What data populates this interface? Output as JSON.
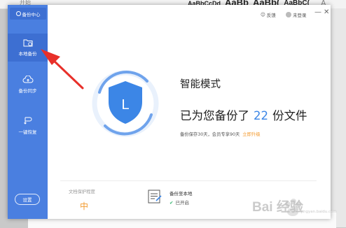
{
  "background": {
    "tab_label": "开始",
    "style_previews": [
      "AaBbCcDd",
      "AaBb",
      "AaBb(",
      "AaBbC("
    ]
  },
  "sidebar": {
    "title": "备份中心",
    "items": [
      {
        "label": "本地备份",
        "icon": "folder-clock-icon",
        "active": true
      },
      {
        "label": "备份同步",
        "icon": "cloud-upload-icon",
        "active": false
      },
      {
        "label": "一键恢复",
        "icon": "restore-icon",
        "active": false
      }
    ],
    "settings_label": "设置"
  },
  "topbar": {
    "feedback_label": "反馈",
    "login_label": "未登录",
    "minimize_symbol": "—",
    "close_symbol": "✕"
  },
  "main": {
    "mode_title": "智能模式",
    "backup_prefix": "已为您备份了",
    "backup_count": "22",
    "backup_suffix": "份文件",
    "retention_text": "备份保存30天，会员专享90天",
    "upgrade_link": "立即升级",
    "shield_letter": "L"
  },
  "footer": {
    "protection_label": "文档保护程度",
    "protection_value": "中",
    "local_backup_label": "备份至本地",
    "local_backup_status": "已开启"
  },
  "watermark": {
    "text": "Bai 经验",
    "url": "jingyan.baidu.com"
  },
  "colors": {
    "sidebar": "#4a7fe0",
    "sidebar_active": "#3d6fd2",
    "accent_blue": "#3c86e6",
    "accent_orange": "#f39a2e",
    "arrow_red": "#e8302a"
  }
}
